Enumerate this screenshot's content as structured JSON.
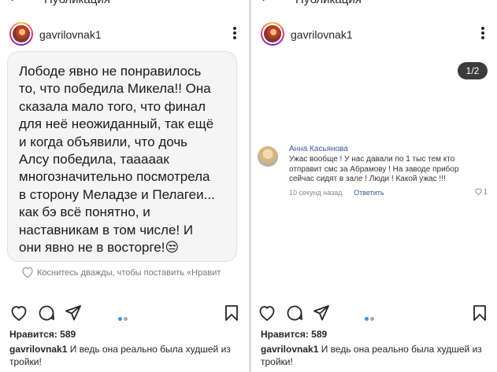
{
  "left": {
    "topbar": {
      "back_icon": "chevron-left-icon",
      "title": "Публикация"
    },
    "username": "gavrilovnak1",
    "note_lines": [
      "Лободе явно не понравилось",
      "то, что победила Микела!! Она",
      "сказала мало того, что финал",
      "для неё неожиданный, так ещё",
      "и когда объявили, что дочь",
      "Алсу победила, таааaак",
      "многозначительно посмотрела",
      "в сторону Меладзе и Пелагеи...",
      "как бэ всё понятно, и",
      "наставникам в том числе! И",
      "они явно не в восторге!😒"
    ],
    "double_tap_hint": "Коснитесь дважды, чтобы поставить «Нравит",
    "likes": "Нравится: 589",
    "caption_user": "gavrilovnak1",
    "caption_text": " И ведь она реально была худшей из тройки!",
    "active_dot_color": "#3897f0",
    "inactive_dot_color": "#a8a8a8"
  },
  "right": {
    "topbar": {
      "back_icon": "chevron-left-icon",
      "title": "Публикация"
    },
    "username": "gavrilovnak1",
    "counter": "1/2",
    "comment": {
      "author": "Анна Касьянова",
      "lines": [
        "Ужас вообще ! У нас давали по 1 тыс тем кто",
        "отправит смс за Абрамову ! На заводе прибор",
        "сейчас сидят в зале ! Люди ! Какой ужас !!!"
      ],
      "time": "10 секунд назад",
      "reply": "Ответить",
      "likes": "1"
    },
    "likes": "Нравится: 589",
    "caption_user": "gavrilovnak1",
    "caption_text": " И ведь она реально была худшей из тройки!"
  }
}
